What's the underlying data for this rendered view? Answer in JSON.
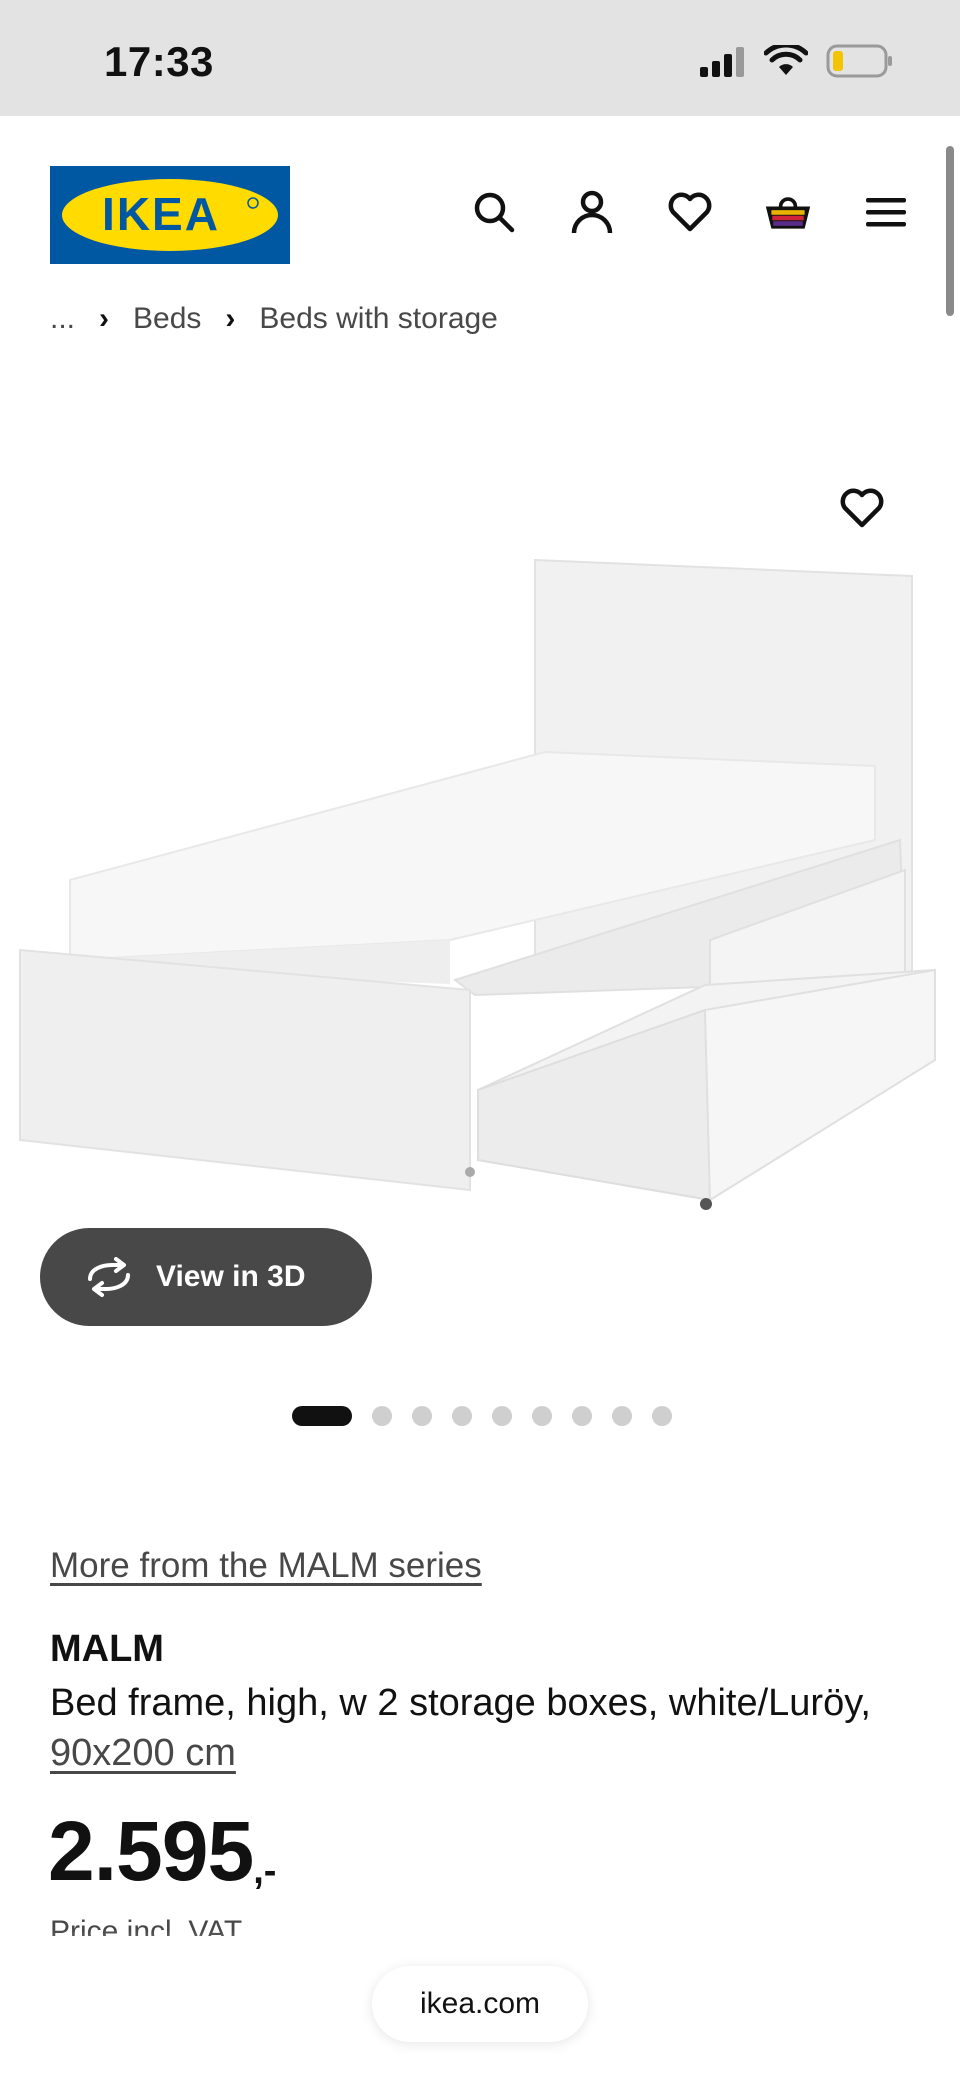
{
  "status_bar": {
    "time": "17:33"
  },
  "header": {
    "logo_text": "IKEA",
    "icons": [
      "search-icon",
      "user-icon",
      "heart-icon",
      "cart-icon",
      "menu-icon"
    ]
  },
  "breadcrumb": {
    "ellipsis": "...",
    "items": [
      "Beds",
      "Beds with storage"
    ]
  },
  "gallery": {
    "view_3d_label": "View in 3D",
    "dot_count": 9,
    "active_dot": 0
  },
  "product": {
    "series_link": "More from the MALM series",
    "name": "MALM",
    "description": "Bed frame, high, w 2 storage boxes, white/Luröy, ",
    "size_link": "90x200 cm",
    "price": "2.595",
    "price_suffix": ",-",
    "vat_note": "Price incl. VAT"
  },
  "browser": {
    "url": "ikea.com"
  },
  "colors": {
    "ikea_blue": "#0058a3",
    "ikea_yellow": "#ffdb00",
    "pill_dark": "#484848"
  }
}
